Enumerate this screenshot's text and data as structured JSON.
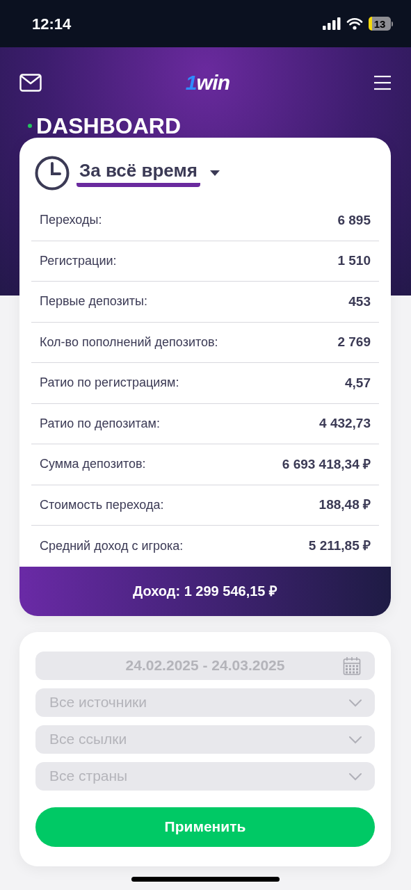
{
  "status_bar": {
    "time": "12:14",
    "battery": "13"
  },
  "header": {
    "logo": "1win",
    "title": "DASHBOARD"
  },
  "period": {
    "label": "За всё время"
  },
  "stats": [
    {
      "label": "Переходы:",
      "value": "6 895"
    },
    {
      "label": "Регистрации:",
      "value": "1 510"
    },
    {
      "label": "Первые депозиты:",
      "value": "453"
    },
    {
      "label": "Кол-во пополнений депозитов:",
      "value": "2 769"
    },
    {
      "label": "Ратио по регистрациям:",
      "value": "4,57"
    },
    {
      "label": "Ратио по депозитам:",
      "value": "4 432,73"
    },
    {
      "label": "Сумма депозитов:",
      "value": "6 693 418,34 ₽"
    },
    {
      "label": "Стоимость перехода:",
      "value": "188,48 ₽"
    },
    {
      "label": "Средний доход с игрока:",
      "value": "5 211,85 ₽"
    }
  ],
  "income": "Доход: 1 299 546,15 ₽",
  "filters": [
    {
      "kind": "date",
      "placeholder": "24.02.2025 - 24.03.2025"
    },
    {
      "kind": "select",
      "placeholder": "Все источники"
    },
    {
      "kind": "select",
      "placeholder": "Все ссылки"
    },
    {
      "kind": "select",
      "placeholder": "Все страны"
    }
  ],
  "apply_button": "Применить"
}
